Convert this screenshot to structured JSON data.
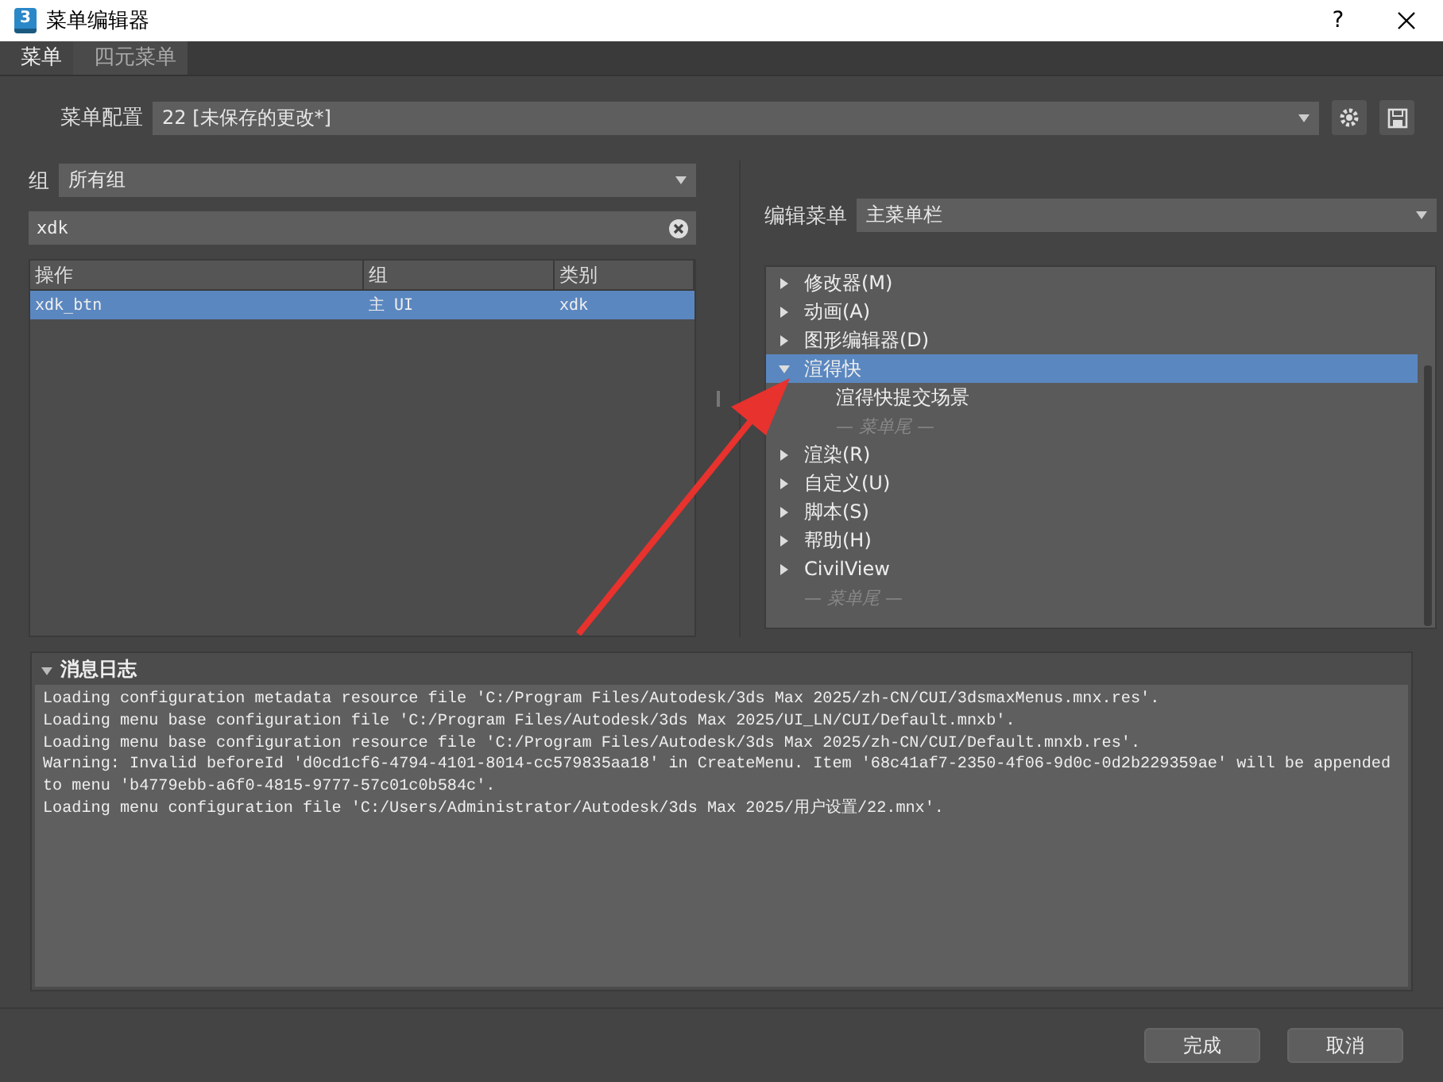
{
  "window": {
    "icon_text": "3",
    "title": "菜单编辑器",
    "help": "?"
  },
  "tabs": [
    {
      "label": "菜单",
      "selected": true
    },
    {
      "label": "四元菜单",
      "selected": false
    }
  ],
  "menu_config": {
    "label": "菜单配置",
    "value": "22 [未保存的更改*]"
  },
  "group_filter": {
    "label": "组",
    "value": "所有组"
  },
  "search": {
    "value": "xdk"
  },
  "table": {
    "columns": [
      "操作",
      "组",
      "类别"
    ],
    "rows": [
      {
        "cells": [
          "xdk_btn",
          "主 UI",
          "xdk"
        ],
        "selected": true
      }
    ]
  },
  "edit_menu": {
    "label": "编辑菜单",
    "value": "主菜单栏"
  },
  "tree": [
    {
      "kind": "menu",
      "label": "修改器(M)",
      "expanded": false,
      "selected": false
    },
    {
      "kind": "menu",
      "label": "动画(A)",
      "expanded": false,
      "selected": false
    },
    {
      "kind": "menu",
      "label": "图形编辑器(D)",
      "expanded": false,
      "selected": false
    },
    {
      "kind": "menu",
      "label": "渲得快",
      "expanded": true,
      "selected": true,
      "children": [
        {
          "kind": "action",
          "label": "渲得快提交场景",
          "selected": false
        },
        {
          "kind": "end",
          "label": "— 菜单尾 —"
        }
      ]
    },
    {
      "kind": "menu",
      "label": "渲染(R)",
      "expanded": false,
      "selected": false
    },
    {
      "kind": "menu",
      "label": "自定义(U)",
      "expanded": false,
      "selected": false
    },
    {
      "kind": "menu",
      "label": "脚本(S)",
      "expanded": false,
      "selected": false
    },
    {
      "kind": "menu",
      "label": "帮助(H)",
      "expanded": false,
      "selected": false
    },
    {
      "kind": "menu",
      "label": "CivilView",
      "expanded": false,
      "selected": false
    },
    {
      "kind": "end",
      "label": "— 菜单尾 —"
    }
  ],
  "log": {
    "title": "消息日志",
    "expanded": true,
    "lines": [
      "Loading configuration metadata resource file 'C:/Program Files/Autodesk/3ds Max 2025/zh-CN/CUI/3dsmaxMenus.mnx.res'.",
      "Loading menu base configuration file 'C:/Program Files/Autodesk/3ds Max 2025/UI_LN/CUI/Default.mnxb'.",
      "Loading menu base configuration resource file 'C:/Program Files/Autodesk/3ds Max 2025/zh-CN/CUI/Default.mnxb.res'.",
      "Warning: Invalid beforeId 'd0cd1cf6-4794-4101-8014-cc579835aa18' in CreateMenu. Item '68c41af7-2350-4f06-9d0c-0d2b229359ae' will be appended to menu 'b4779ebb-a6f0-4815-9777-57c01c0b584c'.",
      "Loading menu configuration file 'C:/Users/Administrator/Autodesk/3ds Max 2025/用户设置/22.mnx'."
    ]
  },
  "buttons": [
    "完成",
    "取消"
  ]
}
